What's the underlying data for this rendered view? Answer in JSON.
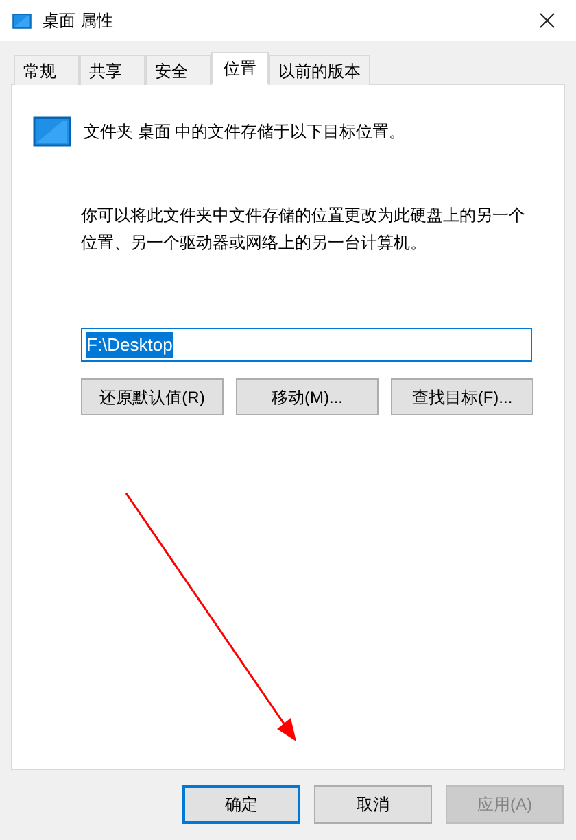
{
  "window": {
    "title": "桌面 属性"
  },
  "tabs": [
    {
      "label": "常规",
      "selected": false
    },
    {
      "label": "共享",
      "selected": false
    },
    {
      "label": "安全",
      "selected": false
    },
    {
      "label": "位置",
      "selected": true
    },
    {
      "label": "以前的版本",
      "selected": false
    }
  ],
  "heading": "文件夹 桌面 中的文件存储于以下目标位置。",
  "description": "你可以将此文件夹中文件存储的位置更改为此硬盘上的另一个位置、另一个驱动器或网络上的另一台计算机。",
  "path_field": {
    "value": "F:\\Desktop",
    "text_selected": true
  },
  "location_buttons": [
    "还原默认值(R)",
    "移动(M)...",
    "查找目标(F)..."
  ],
  "dialog_buttons": [
    {
      "label": "确定",
      "default": true,
      "disabled": false
    },
    {
      "label": "取消",
      "default": false,
      "disabled": false
    },
    {
      "label": "应用(A)",
      "default": false,
      "disabled": true
    }
  ]
}
